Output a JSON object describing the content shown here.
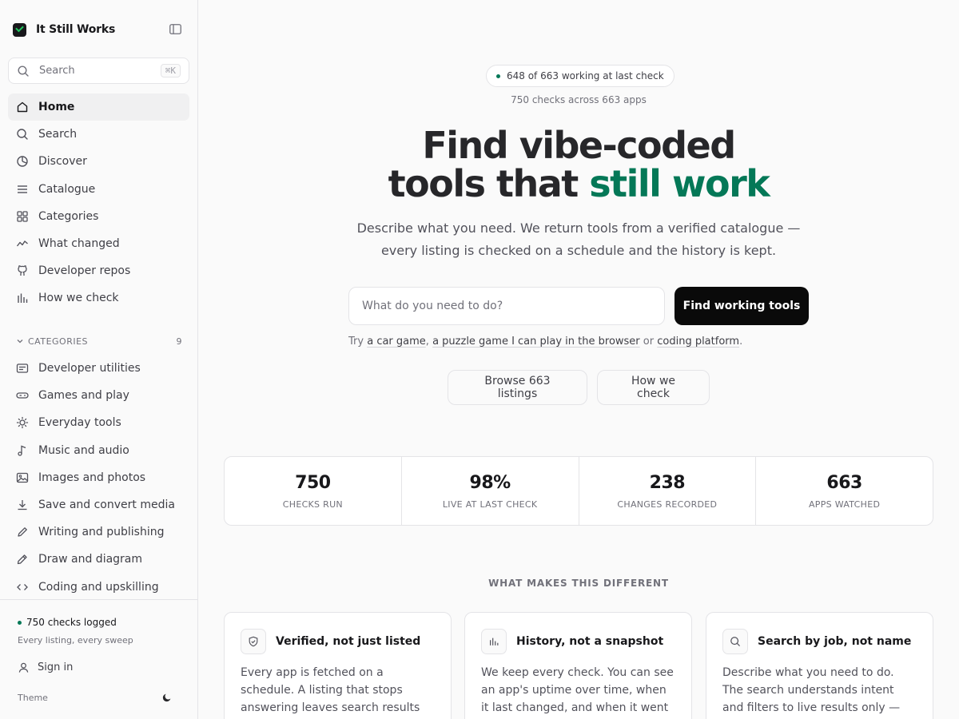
{
  "brand": {
    "name": "It Still Works"
  },
  "search": {
    "placeholder": "Search",
    "shortcut": "⌘K"
  },
  "nav": [
    {
      "label": "Home",
      "icon": "home-icon",
      "active": true
    },
    {
      "label": "Search",
      "icon": "search-icon"
    },
    {
      "label": "Discover",
      "icon": "compass-icon"
    },
    {
      "label": "Catalogue",
      "icon": "list-icon"
    },
    {
      "label": "Categories",
      "icon": "grid-icon"
    },
    {
      "label": "What changed",
      "icon": "activity-icon"
    },
    {
      "label": "Developer repos",
      "icon": "github-icon"
    },
    {
      "label": "How we check",
      "icon": "bar-chart-icon"
    }
  ],
  "categories": {
    "heading": "CATEGORIES",
    "count": "9",
    "items": [
      {
        "label": "Developer utilities",
        "icon": "terminal-icon"
      },
      {
        "label": "Games and play",
        "icon": "gamepad-icon"
      },
      {
        "label": "Everyday tools",
        "icon": "sun-icon"
      },
      {
        "label": "Music and audio",
        "icon": "music-icon"
      },
      {
        "label": "Images and photos",
        "icon": "image-icon"
      },
      {
        "label": "Save and convert media",
        "icon": "download-icon"
      },
      {
        "label": "Writing and publishing",
        "icon": "pen-icon"
      },
      {
        "label": "Draw and diagram",
        "icon": "pencil-icon"
      },
      {
        "label": "Coding and upskilling",
        "icon": "code-icon"
      }
    ]
  },
  "footer": {
    "status": "750 checks logged",
    "sub": "Every listing, every sweep",
    "signin": "Sign in",
    "theme": "Theme"
  },
  "hero": {
    "pill": "648 of 663 working at last check",
    "pill_sub": "750 checks across 663 apps",
    "title_line1": "Find vibe-coded",
    "title_line2_a": "tools that ",
    "title_line2_b": "still work",
    "lede": "Describe what you need. We return tools from a verified catalogue — every listing is checked on a schedule and the history is kept.",
    "query_placeholder": "What do you need to do?",
    "cta": "Find working tools",
    "try_prefix": "Try",
    "try_1": "a car game",
    "try_sep1": ",",
    "try_2": "a puzzle game I can play in the browser",
    "try_or": "or",
    "try_3": "coding platform",
    "try_end": ".",
    "browse": "Browse 663 listings",
    "how": "How we check"
  },
  "stats": [
    {
      "value": "750",
      "label": "CHECKS RUN"
    },
    {
      "value": "98%",
      "label": "LIVE AT LAST CHECK"
    },
    {
      "value": "238",
      "label": "CHANGES RECORDED"
    },
    {
      "value": "663",
      "label": "APPS WATCHED"
    }
  ],
  "features": {
    "heading": "WHAT MAKES THIS DIFFERENT",
    "cards": [
      {
        "title": "Verified, not just listed",
        "icon": "shield-check-icon",
        "body": "Every app is fetched on a schedule. A listing that stops answering leaves search results automatically — we"
      },
      {
        "title": "History, not a snapshot",
        "icon": "bar-chart-icon",
        "body": "We keep every check. You can see an app's uptime over time, when it last changed, and when it went down —"
      },
      {
        "title": "Search by job, not name",
        "icon": "search-icon",
        "body": "Describe what you need to do. The search understands intent and filters to live results only — no dead links, no"
      }
    ]
  },
  "colors": {
    "accent": "#047857",
    "cta": "#0a0a0a",
    "border": "#e4e4e7"
  }
}
